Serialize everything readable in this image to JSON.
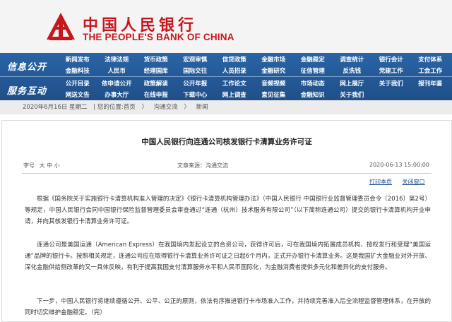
{
  "header": {
    "logo_cn": "中国人民银行",
    "logo_en": "THE PEOPLE'S BANK OF CHINA",
    "colors": {
      "brand_red": "#c8161d",
      "nav_blue": "#2a64a6"
    }
  },
  "nav": {
    "info_title": "信息公开",
    "service_title": "服务互动",
    "row1": [
      "新闻发布",
      "法律法规",
      "货币政策",
      "宏观审慎",
      "信贷政策",
      "金融市场",
      "金融稳定",
      "调查统计",
      "银行会计",
      "支付体系"
    ],
    "row2": [
      "金融科技",
      "人民币",
      "经理国库",
      "国际交往",
      "人员招录",
      "金融研究",
      "征信管理",
      "反洗钱",
      "党建工作",
      "工会工作"
    ],
    "row3": [
      "公开目录",
      "依申请公开",
      "政策解读",
      "公开年报",
      "工作论文",
      "音频视频",
      "市场动态",
      "网上展厅",
      "关于我们",
      "报刊年鉴"
    ],
    "row4": [
      "网送文告",
      "办事大厅",
      "在线申报",
      "下载中心",
      "网上调查",
      "意见征集",
      "金融知识",
      "关于我们"
    ]
  },
  "breadcrumb": {
    "date": "2020年6月16日 星期二",
    "here": "| 您的位置:首页",
    "sep1": "〉",
    "section": "沟通交流",
    "sep2": "〉",
    "page": "新闻"
  },
  "article": {
    "title": "中国人民银行向连通公司核发银行卡清算业务许可证",
    "font_label": "字号",
    "font_large": "大",
    "font_mid": "中",
    "font_small": "小",
    "source": "文章来源：沟通交流",
    "date": "2020-06-13 15:00:00",
    "print": "打印本页",
    "close": "关闭窗口",
    "p1": "根据《国务院关于实施银行卡清算机构准入管理的决定》《银行卡清算机构管理办法》（中国人民银行 中国银行业监督管理委员会令〔2016〕第2号）等规定，中国人民银行会同中国银行保险监督管理委员会审查通过“连通（杭州）技术服务有限公司”（以下简称连通公司）提交的银行卡清算机构开业申请，并向其核发银行卡清算业务许可证。",
    "p2": "连通公司是美国运通（American Express）在我国境内发起设立的合资公司，获得许可后，可在我国境内拓展成员机构、授权发行和受理“美国运通”品牌的银行卡。按照相关规定，连通公司应在取得银行卡清算业务许可证之日起6个月内，正式开办银行卡清算业务。这是我国扩大金融业对外开放、深化金融供给侧改革的又一具体反映，有利于提高我国支付清算服务水平和人民币国际化，为金融消费者提供多元化和差异化的支付服务。",
    "p3": "下一步，中国人民银行将继续遵循公开、公平、公正的原则，依法有序推进银行卡市场准入工作，并持续完善准入后全流程监督管理体系，在开放的同时切实维护金融稳定。（完）"
  }
}
